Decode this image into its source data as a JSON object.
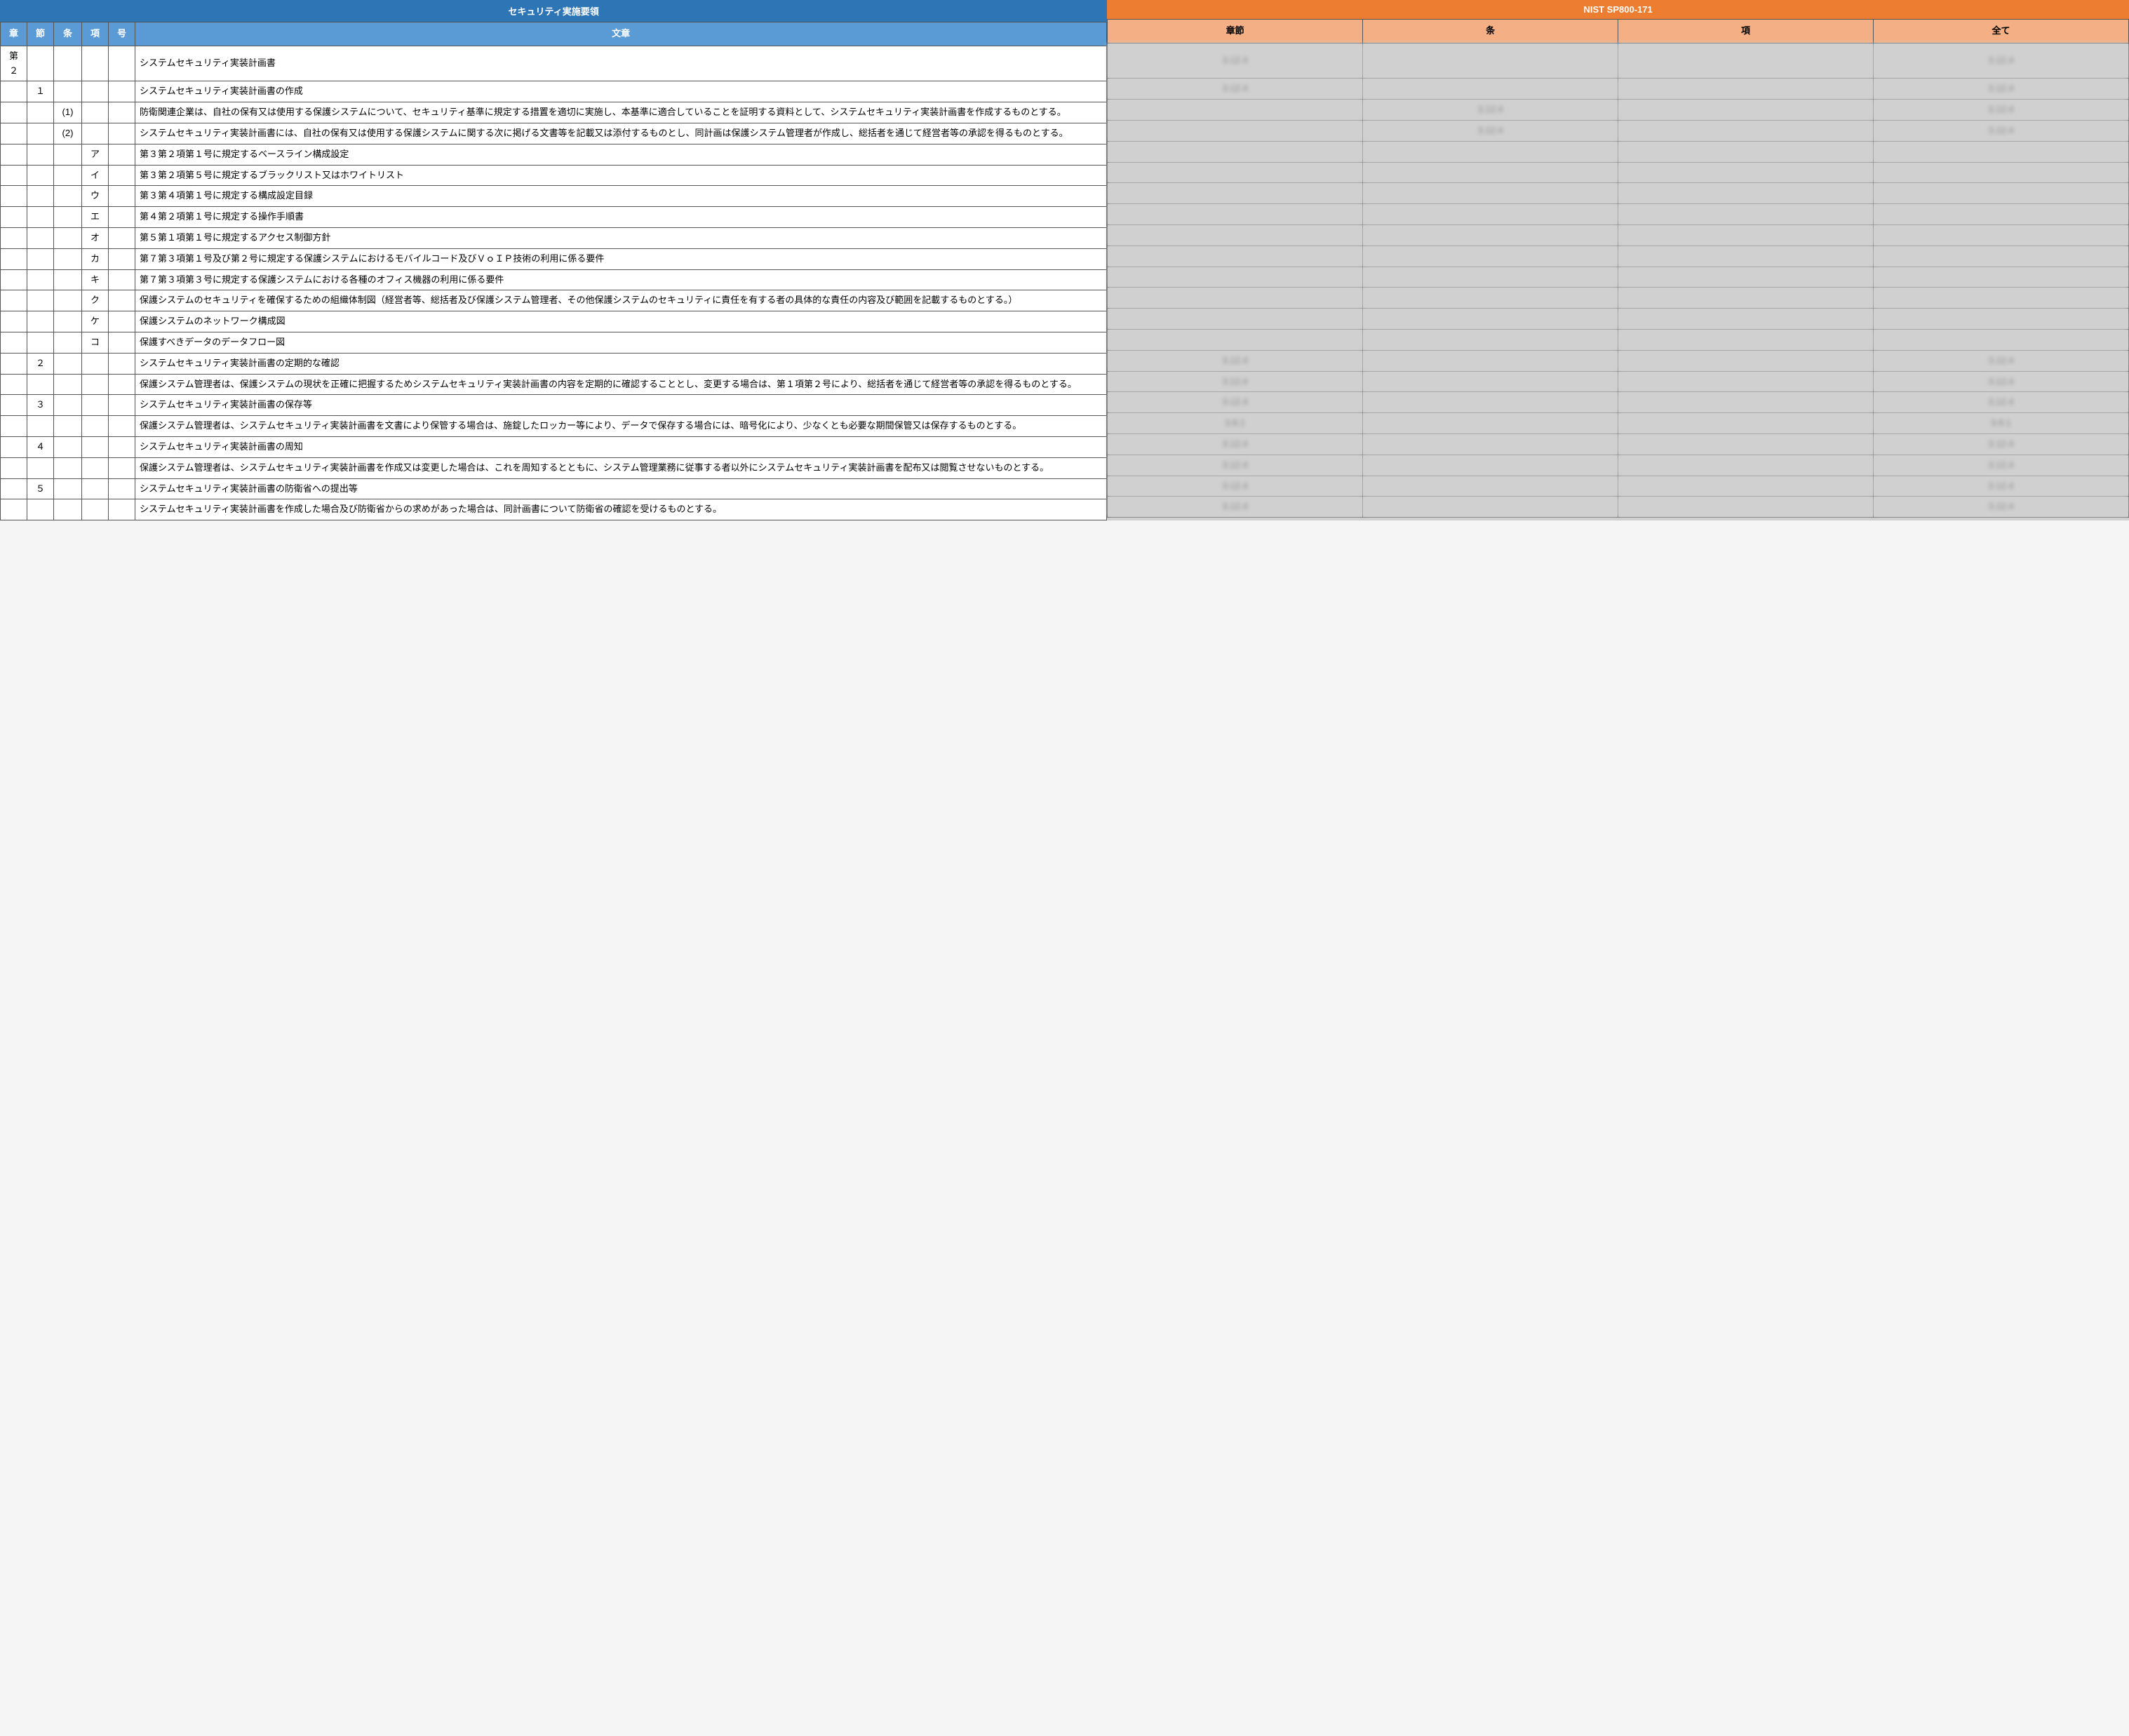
{
  "left": {
    "title": "セキュリティ実施要領",
    "headers": [
      "章",
      "節",
      "条",
      "項",
      "号",
      "文章"
    ],
    "rows": [
      {
        "c1": "第２",
        "c2": "",
        "c3": "",
        "c4": "",
        "c5": "",
        "text": "システムセキュリティ実装計画書"
      },
      {
        "c1": "",
        "c2": "１",
        "c3": "",
        "c4": "",
        "c5": "",
        "text": "システムセキュリティ実装計画書の作成"
      },
      {
        "c1": "",
        "c2": "",
        "c3": "(1)",
        "c4": "",
        "c5": "",
        "text": "防衛関連企業は、自社の保有又は使用する保護システムについて、セキュリティ基準に規定する措置を適切に実施し、本基準に適合していることを証明する資料として、システムセキュリティ実装計画書を作成するものとする。"
      },
      {
        "c1": "",
        "c2": "",
        "c3": "(2)",
        "c4": "",
        "c5": "",
        "text": "システムセキュリティ実装計画書には、自社の保有又は使用する保護システムに関する次に掲げる文書等を記載又は添付するものとし、同計画は保護システム管理者が作成し、総括者を通じて経営者等の承認を得るものとする。"
      },
      {
        "c1": "",
        "c2": "",
        "c3": "",
        "c4": "ア",
        "c5": "",
        "text": "第３第２項第１号に規定するベースライン構成設定"
      },
      {
        "c1": "",
        "c2": "",
        "c3": "",
        "c4": "イ",
        "c5": "",
        "text": "第３第２項第５号に規定するブラックリスト又はホワイトリスト"
      },
      {
        "c1": "",
        "c2": "",
        "c3": "",
        "c4": "ウ",
        "c5": "",
        "text": "第３第４項第１号に規定する構成設定目録"
      },
      {
        "c1": "",
        "c2": "",
        "c3": "",
        "c4": "エ",
        "c5": "",
        "text": "第４第２項第１号に規定する操作手順書"
      },
      {
        "c1": "",
        "c2": "",
        "c3": "",
        "c4": "オ",
        "c5": "",
        "text": "第５第１項第１号に規定するアクセス制御方針"
      },
      {
        "c1": "",
        "c2": "",
        "c3": "",
        "c4": "カ",
        "c5": "",
        "text": "第７第３項第１号及び第２号に規定する保護システムにおけるモバイルコード及びＶｏＩＰ技術の利用に係る要件"
      },
      {
        "c1": "",
        "c2": "",
        "c3": "",
        "c4": "キ",
        "c5": "",
        "text": "第７第３項第３号に規定する保護システムにおける各種のオフィス機器の利用に係る要件"
      },
      {
        "c1": "",
        "c2": "",
        "c3": "",
        "c4": "ク",
        "c5": "",
        "text": "保護システムのセキュリティを確保するための組織体制図（経営者等、総括者及び保護システム管理者、その他保護システムのセキュリティに責任を有する者の具体的な責任の内容及び範囲を記載するものとする。）"
      },
      {
        "c1": "",
        "c2": "",
        "c3": "",
        "c4": "ケ",
        "c5": "",
        "text": "保護システムのネットワーク構成図"
      },
      {
        "c1": "",
        "c2": "",
        "c3": "",
        "c4": "コ",
        "c5": "",
        "text": "保護すべきデータのデータフロー図"
      },
      {
        "c1": "",
        "c2": "２",
        "c3": "",
        "c4": "",
        "c5": "",
        "text": "システムセキュリティ実装計画書の定期的な確認"
      },
      {
        "c1": "",
        "c2": "",
        "c3": "",
        "c4": "",
        "c5": "",
        "text": "保護システム管理者は、保護システムの現状を正確に把握するためシステムセキュリティ実装計画書の内容を定期的に確認することとし、変更する場合は、第１項第２号により、総括者を通じて経営者等の承認を得るものとする。"
      },
      {
        "c1": "",
        "c2": "３",
        "c3": "",
        "c4": "",
        "c5": "",
        "text": "システムセキュリティ実装計画書の保存等"
      },
      {
        "c1": "",
        "c2": "",
        "c3": "",
        "c4": "",
        "c5": "",
        "text": "保護システム管理者は、システムセキュリティ実装計画書を文書により保管する場合は、施錠したロッカー等により、データで保存する場合には、暗号化により、少なくとも必要な期間保管又は保存するものとする。"
      },
      {
        "c1": "",
        "c2": "４",
        "c3": "",
        "c4": "",
        "c5": "",
        "text": "システムセキュリティ実装計画書の周知"
      },
      {
        "c1": "",
        "c2": "",
        "c3": "",
        "c4": "",
        "c5": "",
        "text": "保護システム管理者は、システムセキュリティ実装計画書を作成又は変更した場合は、これを周知するとともに、システム管理業務に従事する者以外にシステムセキュリティ実装計画書を配布又は閲覧させないものとする。"
      },
      {
        "c1": "",
        "c2": "５",
        "c3": "",
        "c4": "",
        "c5": "",
        "text": "システムセキュリティ実装計画書の防衛省への提出等"
      },
      {
        "c1": "",
        "c2": "",
        "c3": "",
        "c4": "",
        "c5": "",
        "text": "システムセキュリティ実装計画書を作成した場合及び防衛省からの求めがあった場合は、同計画書について防衛省の確認を受けるものとする。"
      }
    ]
  },
  "right": {
    "title": "NIST SP800-171",
    "headers": [
      "章節",
      "条",
      "項",
      "全て"
    ],
    "rows": [
      {
        "a": "3.12.4",
        "b": "",
        "c": "",
        "d": "3.12.4"
      },
      {
        "a": "3.12.4",
        "b": "",
        "c": "",
        "d": "3.12.4"
      },
      {
        "a": "",
        "b": "3.12.4",
        "c": "",
        "d": "3.12.4"
      },
      {
        "a": "",
        "b": "3.12.4",
        "c": "",
        "d": "3.12.4"
      },
      {
        "a": "",
        "b": "",
        "c": "",
        "d": ""
      },
      {
        "a": "",
        "b": "",
        "c": "",
        "d": ""
      },
      {
        "a": "",
        "b": "",
        "c": "",
        "d": ""
      },
      {
        "a": "",
        "b": "",
        "c": "",
        "d": ""
      },
      {
        "a": "",
        "b": "",
        "c": "",
        "d": ""
      },
      {
        "a": "",
        "b": "",
        "c": "",
        "d": ""
      },
      {
        "a": "",
        "b": "",
        "c": "",
        "d": ""
      },
      {
        "a": "",
        "b": "",
        "c": "",
        "d": ""
      },
      {
        "a": "",
        "b": "",
        "c": "",
        "d": ""
      },
      {
        "a": "",
        "b": "",
        "c": "",
        "d": ""
      },
      {
        "a": "3.12.4",
        "b": "",
        "c": "",
        "d": "3.12.4"
      },
      {
        "a": "3.12.4",
        "b": "",
        "c": "",
        "d": "3.12.4"
      },
      {
        "a": "3.12.4",
        "b": "",
        "c": "",
        "d": "3.12.4"
      },
      {
        "a": "3.8.1",
        "b": "",
        "c": "",
        "d": "3.8.1"
      },
      {
        "a": "3.12.4",
        "b": "",
        "c": "",
        "d": "3.12.4"
      },
      {
        "a": "3.12.4",
        "b": "",
        "c": "",
        "d": "3.12.4"
      },
      {
        "a": "3.12.4",
        "b": "",
        "c": "",
        "d": "3.12.4"
      },
      {
        "a": "3.12.4",
        "b": "",
        "c": "",
        "d": "3.12.4"
      }
    ]
  }
}
